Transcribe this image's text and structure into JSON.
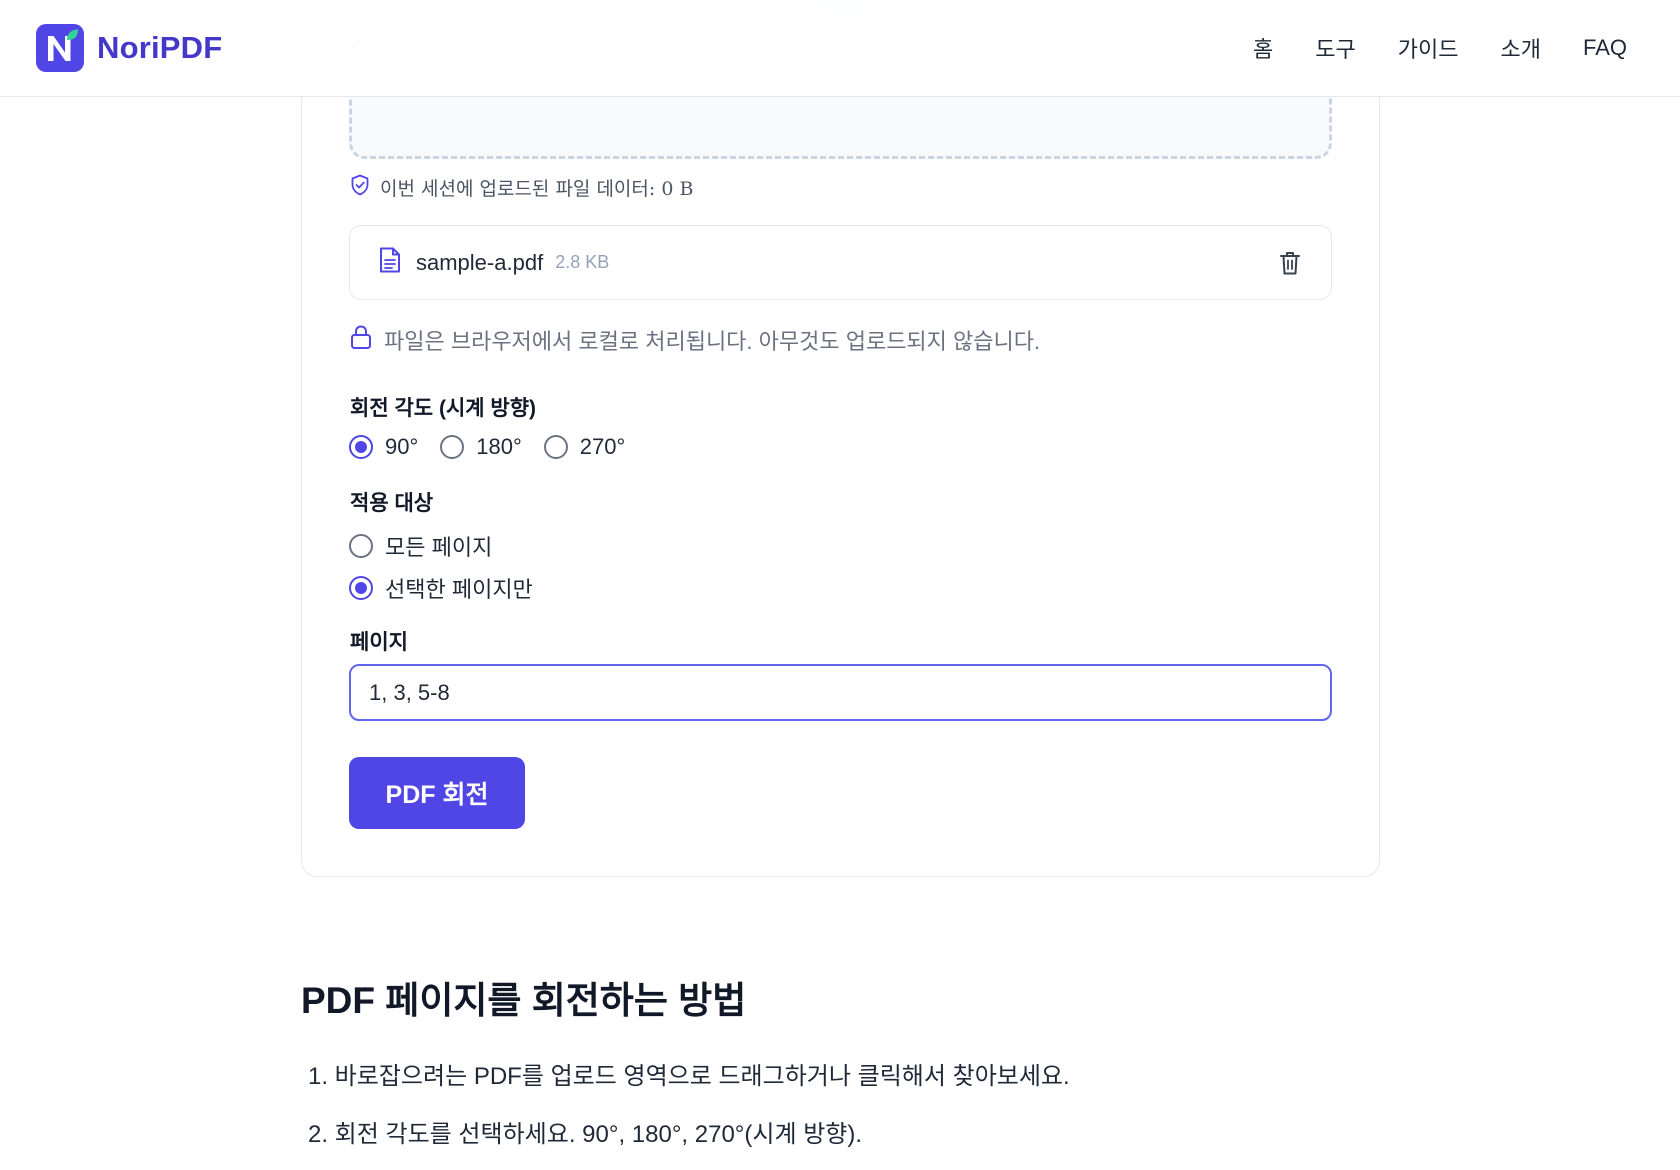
{
  "header": {
    "brand": "NoriPDF",
    "nav": [
      "홈",
      "도구",
      "가이드",
      "소개",
      "FAQ"
    ]
  },
  "tool": {
    "session_note": "이번 세션에 업로드된 파일 데이터: 0 B",
    "file": {
      "name": "sample-a.pdf",
      "size": "2.8 KB"
    },
    "local_note": "파일은 브라우저에서 로컬로 처리됩니다. 아무것도 업로드되지 않습니다.",
    "angle_label": "회전 각도 (시계 방향)",
    "angles": [
      "90°",
      "180°",
      "270°"
    ],
    "angle_selected": "90°",
    "target_label": "적용 대상",
    "targets": [
      "모든 페이지",
      "선택한 페이지만"
    ],
    "target_selected": "선택한 페이지만",
    "pages_label": "페이지",
    "pages_value": "1, 3, 5-8",
    "button": "PDF 회전"
  },
  "howto": {
    "title": "PDF 페이지를 회전하는 방법",
    "steps": [
      "1. 바로잡으려는 PDF를 업로드 영역으로 드래그하거나 클릭해서 찾아보세요.",
      "2. 회전 각도를 선택하세요. 90°, 180°, 270°(시계 방향)."
    ]
  },
  "colors": {
    "accent": "#4f46e5",
    "brand_text": "#4338ca",
    "logo_leaf": "#34d399",
    "muted": "#6b7280",
    "border": "#e5e7eb"
  },
  "icons": [
    "logo-icon",
    "shield-check-icon",
    "file-icon",
    "trash-icon",
    "lock-icon"
  ]
}
